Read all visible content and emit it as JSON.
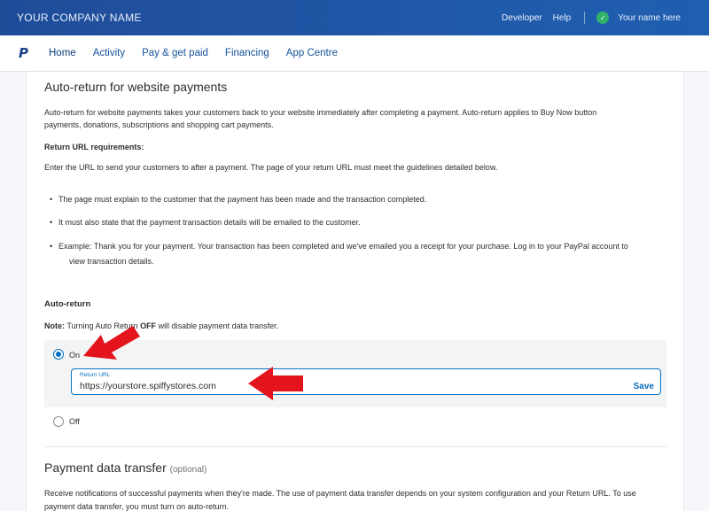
{
  "header": {
    "company_name": "YOUR COMPANY NAME",
    "developer_label": "Developer",
    "help_label": "Help",
    "user_name": "Your name here"
  },
  "nav": {
    "logo": "P",
    "items": [
      {
        "label": "Home"
      },
      {
        "label": "Activity"
      },
      {
        "label": "Pay & get paid"
      },
      {
        "label": "Financing"
      },
      {
        "label": "App Centre"
      }
    ]
  },
  "auto_return_section": {
    "title": "Auto-return for website payments",
    "intro_line1": "Auto-return for website payments takes your customers back to your website immediately after completing a payment. Auto-return applies to Buy Now button",
    "intro_line2": "payments, donations, subscriptions and shopping cart payments.",
    "requirements_heading": "Return URL requirements:",
    "requirements_text": "Enter the URL to send your customers to after a payment. The page of your return URL must meet the guidelines detailed below.",
    "bullets": [
      "The page must explain to the customer that the payment has been made and the transaction completed.",
      "It must also state that the payment transaction details will be emailed to the customer.",
      "Example: Thank you for your payment. Your transaction has been completed and we've emailed you a receipt for your purchase. Log in to your PayPal account to",
      "view transaction details."
    ],
    "auto_return_heading": "Auto-return",
    "note_prefix": "Note:",
    "note_mid": " Turning Auto Return ",
    "note_off": "OFF",
    "note_suffix": " will disable payment data transfer.",
    "on_label": "On",
    "off_label": "Off",
    "return_url_label": "Return URL",
    "return_url_value": "https://yourstore.spiffystores.com",
    "save_label": "Save"
  },
  "pdt_section": {
    "title": "Payment data transfer",
    "optional": "(optional)",
    "text_line1": "Receive notifications of successful payments when they're made. The use of payment data transfer depends on your system configuration and your Return URL. To use",
    "text_line2": "payment data transfer, you must turn on auto-return."
  },
  "colors": {
    "header_blue": "#2158a8",
    "link_blue": "#0a74c2",
    "arrow_red": "#e3141b"
  }
}
